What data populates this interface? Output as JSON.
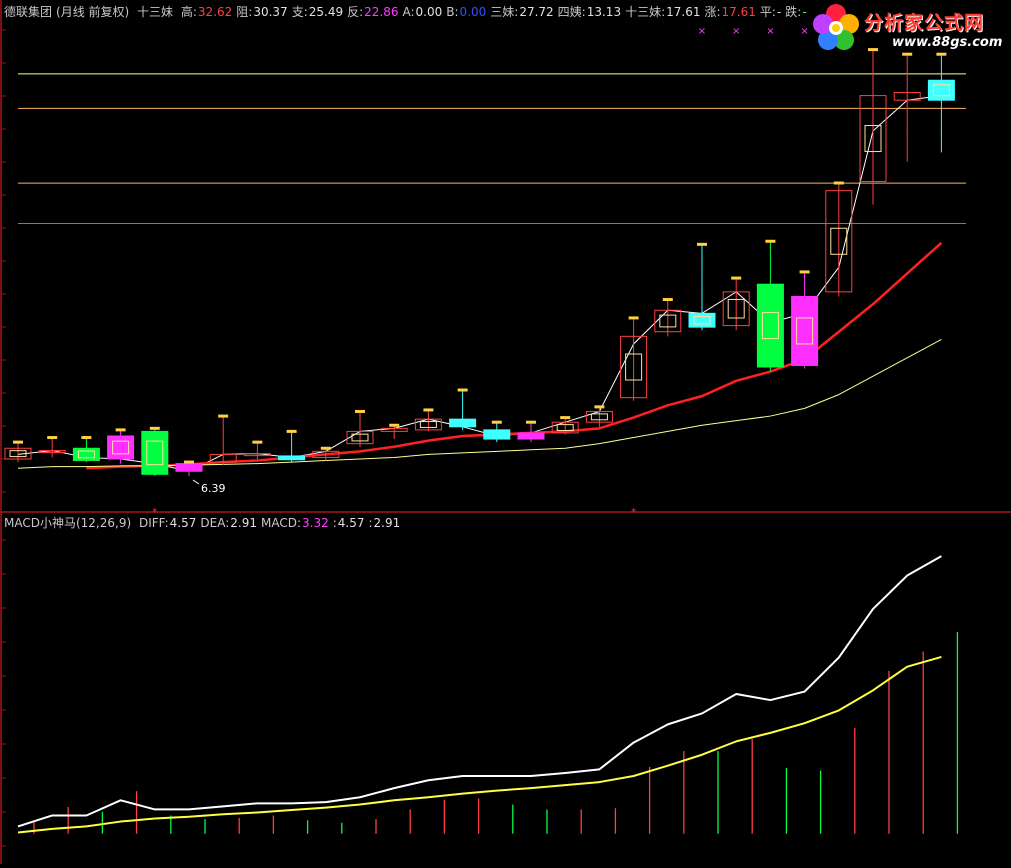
{
  "header": {
    "stock_name": "德联集团",
    "period": "(月线 前复权)",
    "indicator_name": "十三妹",
    "items": [
      {
        "label": "高:",
        "value": "32.62",
        "color": "#ff4040"
      },
      {
        "label": "阻:",
        "value": "30.37",
        "color": "#e0e0e0"
      },
      {
        "label": "支:",
        "value": "25.49",
        "color": "#e0e0e0"
      },
      {
        "label": "反:",
        "value": "22.86",
        "color": "#ff3cff"
      },
      {
        "label": "A:",
        "value": "0.00",
        "color": "#e0e0e0"
      },
      {
        "label": "B:",
        "value": "0.00",
        "color": "#3050ff"
      },
      {
        "label": "三妹:",
        "value": "27.72",
        "color": "#e0e0e0"
      },
      {
        "label": "四姨:",
        "value": "13.13",
        "color": "#e0e0e0"
      },
      {
        "label": "十三妹:",
        "value": "17.61",
        "color": "#e0e0e0"
      },
      {
        "label": "涨:",
        "value": "17.61",
        "color": "#ff4040"
      },
      {
        "label": "平:",
        "value": "-",
        "color": "#e0e0e0"
      },
      {
        "label": "跌:",
        "value": "-",
        "color": "#40ff40"
      }
    ]
  },
  "macd_header": {
    "name": "MACD小神马(12,26,9)",
    "items": [
      {
        "label": "DIFF:",
        "value": "4.57",
        "color": "#e0e0e0"
      },
      {
        "label": "DEA:",
        "value": "2.91",
        "color": "#e0e0e0"
      },
      {
        "label": "MACD:",
        "value": "3.32",
        "color": "#ff3cff"
      },
      {
        "label": ":",
        "value": "4.57",
        "color": "#e0e0e0"
      },
      {
        "label": ":",
        "value": "2.91",
        "color": "#e0e0e0"
      }
    ]
  },
  "watermark": {
    "title": "分析家公式网",
    "url": "www.88gs.com"
  },
  "colors": {
    "up": "#ff4040",
    "down_green": "#00ff40",
    "magenta": "#ff30ff",
    "cyan": "#40ffff",
    "diff": "#ffffff",
    "dea": "#ffff40",
    "ma_red": "#ff2020",
    "ma_yellow": "#ffff90"
  },
  "chart_data": [
    {
      "type": "candlestick",
      "title": "",
      "min_label": "6.39",
      "ylim": [
        4.5,
        36
      ],
      "levels": [
        {
          "name": "阻",
          "value": 30.37,
          "color": "#ffb060"
        },
        {
          "name": "支",
          "value": 25.49,
          "color": "#ffb060"
        },
        {
          "name": "反",
          "value": 22.86,
          "color": "#c040ff"
        },
        {
          "name": "高",
          "value": 32.62,
          "color": "#ffff80"
        }
      ],
      "candles": [
        {
          "o": 7.5,
          "c": 8.2,
          "h": 8.6,
          "l": 7.3,
          "t": "up"
        },
        {
          "o": 8.0,
          "c": 8.05,
          "h": 8.9,
          "l": 7.6,
          "t": "up"
        },
        {
          "o": 8.2,
          "c": 7.4,
          "h": 8.9,
          "l": 7.3,
          "t": "green"
        },
        {
          "o": 9.0,
          "c": 7.5,
          "h": 9.4,
          "l": 7.2,
          "t": "magenta"
        },
        {
          "o": 9.3,
          "c": 6.5,
          "h": 9.5,
          "l": 6.4,
          "t": "green"
        },
        {
          "o": 7.2,
          "c": 6.7,
          "h": 7.3,
          "l": 6.39,
          "t": "magenta"
        },
        {
          "o": 7.3,
          "c": 7.8,
          "h": 10.3,
          "l": 7.1,
          "t": "up"
        },
        {
          "o": 7.8,
          "c": 7.85,
          "h": 8.6,
          "l": 7.5,
          "t": "up"
        },
        {
          "o": 7.7,
          "c": 7.45,
          "h": 9.3,
          "l": 7.3,
          "t": "cyan"
        },
        {
          "o": 7.6,
          "c": 8.0,
          "h": 8.2,
          "l": 7.4,
          "t": "up"
        },
        {
          "o": 8.5,
          "c": 9.3,
          "h": 10.6,
          "l": 8.3,
          "t": "up"
        },
        {
          "o": 9.3,
          "c": 9.5,
          "h": 9.7,
          "l": 8.8,
          "t": "up"
        },
        {
          "o": 9.4,
          "c": 10.1,
          "h": 10.7,
          "l": 9.3,
          "t": "up"
        },
        {
          "o": 10.1,
          "c": 9.6,
          "h": 12.0,
          "l": 9.4,
          "t": "cyan"
        },
        {
          "o": 9.4,
          "c": 8.8,
          "h": 9.9,
          "l": 8.6,
          "t": "cyan"
        },
        {
          "o": 8.8,
          "c": 9.2,
          "h": 9.9,
          "l": 8.6,
          "t": "magenta"
        },
        {
          "o": 9.2,
          "c": 9.9,
          "h": 10.2,
          "l": 9.1,
          "t": "up"
        },
        {
          "o": 9.9,
          "c": 10.6,
          "h": 10.9,
          "l": 9.6,
          "t": "up"
        },
        {
          "o": 11.5,
          "c": 15.5,
          "h": 16.7,
          "l": 11.3,
          "t": "up"
        },
        {
          "o": 15.8,
          "c": 17.2,
          "h": 17.9,
          "l": 15.5,
          "t": "up"
        },
        {
          "o": 17.0,
          "c": 16.1,
          "h": 21.5,
          "l": 15.9,
          "t": "cyan"
        },
        {
          "o": 16.2,
          "c": 18.4,
          "h": 19.3,
          "l": 15.9,
          "t": "up"
        },
        {
          "o": 18.9,
          "c": 13.5,
          "h": 21.7,
          "l": 13.2,
          "t": "green"
        },
        {
          "o": 18.1,
          "c": 13.6,
          "h": 19.7,
          "l": 13.4,
          "t": "magenta"
        },
        {
          "o": 18.4,
          "c": 25.0,
          "h": 25.5,
          "l": 18.1,
          "t": "up"
        },
        {
          "o": 25.6,
          "c": 31.2,
          "h": 34.2,
          "l": 24.1,
          "t": "up"
        },
        {
          "o": 30.9,
          "c": 31.4,
          "h": 33.9,
          "l": 26.9,
          "t": "up"
        },
        {
          "o": 30.9,
          "c": 32.2,
          "h": 33.9,
          "l": 27.5,
          "t": "cyan"
        }
      ],
      "series": [
        {
          "key": "close_line",
          "values": [
            7.8,
            8.05,
            7.6,
            7.5,
            7.2,
            6.7,
            7.8,
            7.85,
            7.6,
            8.0,
            9.3,
            9.5,
            10.1,
            9.6,
            9.0,
            9.2,
            9.9,
            10.6,
            15.0,
            17.2,
            17.0,
            18.4,
            16.4,
            17.0,
            20.0,
            28.9,
            30.9,
            31.2
          ]
        },
        {
          "key": "ma_red",
          "start": 2,
          "values": [
            6.9,
            7.0,
            7.05,
            7.15,
            7.3,
            7.4,
            7.6,
            7.8,
            8.0,
            8.3,
            8.7,
            9.0,
            9.1,
            9.2,
            9.3,
            9.5,
            10.2,
            11.0,
            11.6,
            12.6,
            13.2,
            14.0,
            15.8,
            17.6,
            19.6,
            21.6
          ]
        },
        {
          "key": "ma_yellow",
          "values": [
            6.9,
            7.0,
            7.0,
            7.05,
            7.05,
            7.1,
            7.15,
            7.2,
            7.3,
            7.4,
            7.5,
            7.6,
            7.8,
            7.9,
            8.0,
            8.1,
            8.2,
            8.5,
            8.9,
            9.3,
            9.7,
            10.0,
            10.3,
            10.8,
            11.7,
            12.9,
            14.1,
            15.3
          ]
        }
      ]
    },
    {
      "type": "macd",
      "title": "",
      "ylim": [
        -0.4,
        5.0
      ],
      "diff": [
        0.12,
        0.3,
        0.3,
        0.55,
        0.4,
        0.4,
        0.45,
        0.5,
        0.5,
        0.52,
        0.6,
        0.75,
        0.88,
        0.95,
        0.95,
        0.95,
        1.0,
        1.06,
        1.5,
        1.8,
        1.98,
        2.3,
        2.2,
        2.34,
        2.9,
        3.7,
        4.25,
        4.57
      ],
      "dea": [
        0.02,
        0.08,
        0.12,
        0.2,
        0.25,
        0.28,
        0.32,
        0.35,
        0.39,
        0.43,
        0.48,
        0.55,
        0.6,
        0.66,
        0.71,
        0.75,
        0.8,
        0.85,
        0.95,
        1.12,
        1.3,
        1.52,
        1.66,
        1.82,
        2.03,
        2.36,
        2.75,
        2.91
      ],
      "macd": [
        0.2,
        0.44,
        0.36,
        0.7,
        0.3,
        0.24,
        0.26,
        0.3,
        0.22,
        0.18,
        0.24,
        0.4,
        0.56,
        0.58,
        0.48,
        0.4,
        0.4,
        0.42,
        1.1,
        1.36,
        1.36,
        1.56,
        1.08,
        1.04,
        1.74,
        2.68,
        3.0,
        3.32
      ],
      "macd_colors": [
        "up",
        "up",
        "green",
        "up",
        "green",
        "green",
        "up",
        "up",
        "green",
        "green",
        "up",
        "up",
        "up",
        "up",
        "green",
        "green",
        "up",
        "up",
        "up",
        "up",
        "green",
        "up",
        "green",
        "green",
        "up",
        "up",
        "up",
        "green"
      ]
    }
  ]
}
